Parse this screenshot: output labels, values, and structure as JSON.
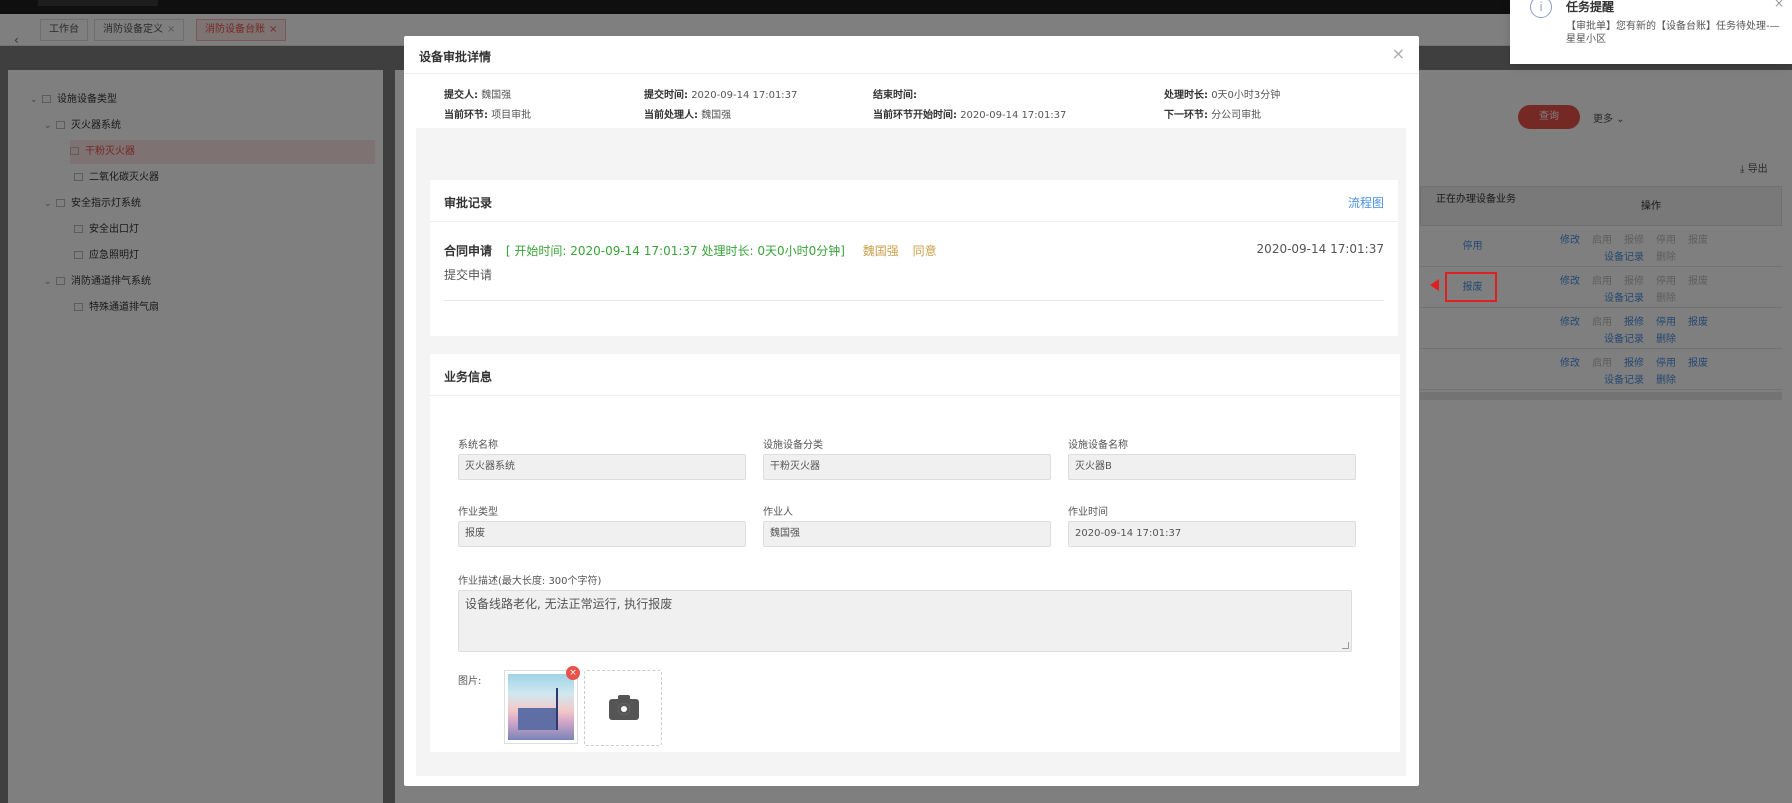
{
  "tabs": [
    {
      "label": "工作台",
      "closable": false,
      "active": false
    },
    {
      "label": "消防设备定义",
      "closable": true,
      "active": false
    },
    {
      "label": "消防设备台账",
      "closable": true,
      "active": true
    }
  ],
  "tree": {
    "root": "设施设备类型",
    "nodes": [
      {
        "label": "灭火器系统",
        "level": 1,
        "expanded": true
      },
      {
        "label": "干粉灭火器",
        "level": 2,
        "selected": true
      },
      {
        "label": "二氧化碳灭火器",
        "level": 2
      },
      {
        "label": "安全指示灯系统",
        "level": 1,
        "expanded": true
      },
      {
        "label": "安全出口灯",
        "level": 2
      },
      {
        "label": "应急照明灯",
        "level": 2
      },
      {
        "label": "消防通道排气系统",
        "level": 1,
        "expanded": true
      },
      {
        "label": "特殊通道排气扇",
        "level": 2
      }
    ]
  },
  "toolbar": {
    "search_label": "查询",
    "more_label": "更多 ⌄",
    "export_label": "导出"
  },
  "table": {
    "headers": [
      "正在办理设备业务",
      "操作"
    ],
    "rows": [
      {
        "status": "停用",
        "ops1": [
          "修改",
          "启用",
          "报修",
          "停用",
          "报废"
        ],
        "ops2": [
          "设备记录",
          "删除"
        ]
      },
      {
        "status": "报废",
        "ops1": [
          "修改",
          "启用",
          "报修",
          "停用",
          "报废"
        ],
        "ops2": [
          "设备记录",
          "删除"
        ]
      },
      {
        "status": "",
        "ops1": [
          "修改",
          "启用",
          "报修",
          "停用",
          "报废"
        ],
        "ops2": [
          "设备记录",
          "删除"
        ]
      },
      {
        "status": "",
        "ops1": [
          "修改",
          "启用",
          "报修",
          "停用",
          "报废"
        ],
        "ops2": [
          "设备记录",
          "删除"
        ]
      }
    ]
  },
  "notification": {
    "title": "任务提醒",
    "body": "【审批单】您有新的【设备台账】任务待处理-—星星小区"
  },
  "modal": {
    "title": "设备审批详情",
    "meta": {
      "submitter_label": "提交人:",
      "submitter": "魏国强",
      "submit_time_label": "提交时间:",
      "submit_time": "2020-09-14 17:01:37",
      "end_time_label": "结束时间:",
      "end_time": "",
      "duration_label": "处理时长:",
      "duration": "0天0小时3分钟",
      "current_step_label": "当前环节:",
      "current_step": "项目审批",
      "current_handler_label": "当前处理人:",
      "current_handler": "魏国强",
      "step_start_label": "当前环节开始时间:",
      "step_start": "2020-09-14 17:01:37",
      "next_step_label": "下一环节:",
      "next_step": "分公司审批"
    },
    "approval": {
      "title": "审批记录",
      "flow_link": "流程图",
      "record": {
        "name": "合同申请",
        "detail": "[ 开始时间: 2020-09-14 17:01:37    处理时长: 0天0小时0分钟]",
        "user": "魏国强",
        "result": "同意",
        "date": "2020-09-14 17:01:37",
        "sub": "提交申请"
      }
    },
    "business": {
      "title": "业务信息",
      "fields": {
        "system_name": {
          "label": "系统名称",
          "value": "灭火器系统"
        },
        "category": {
          "label": "设施设备分类",
          "value": "干粉灭火器"
        },
        "equipment_name": {
          "label": "设施设备名称",
          "value": "灭火器B"
        },
        "work_type": {
          "label": "作业类型",
          "value": "报废"
        },
        "worker": {
          "label": "作业人",
          "value": "魏国强"
        },
        "work_time": {
          "label": "作业时间",
          "value": "2020-09-14 17:01:37"
        },
        "description": {
          "label": "作业描述(最大长度: 300个字符)",
          "value": "设备线路老化, 无法正常运行, 执行报废"
        }
      },
      "images_label": "图片:"
    }
  }
}
